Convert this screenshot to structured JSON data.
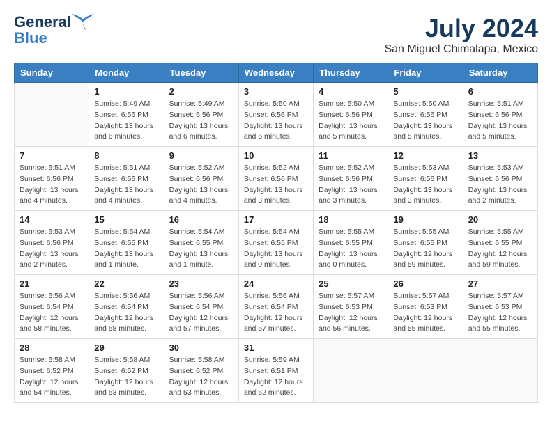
{
  "header": {
    "logo_line1": "General",
    "logo_line2": "Blue",
    "main_title": "July 2024",
    "subtitle": "San Miguel Chimalapa, Mexico"
  },
  "weekdays": [
    "Sunday",
    "Monday",
    "Tuesday",
    "Wednesday",
    "Thursday",
    "Friday",
    "Saturday"
  ],
  "weeks": [
    [
      {
        "day": "",
        "info": ""
      },
      {
        "day": "1",
        "info": "Sunrise: 5:49 AM\nSunset: 6:56 PM\nDaylight: 13 hours\nand 6 minutes."
      },
      {
        "day": "2",
        "info": "Sunrise: 5:49 AM\nSunset: 6:56 PM\nDaylight: 13 hours\nand 6 minutes."
      },
      {
        "day": "3",
        "info": "Sunrise: 5:50 AM\nSunset: 6:56 PM\nDaylight: 13 hours\nand 6 minutes."
      },
      {
        "day": "4",
        "info": "Sunrise: 5:50 AM\nSunset: 6:56 PM\nDaylight: 13 hours\nand 5 minutes."
      },
      {
        "day": "5",
        "info": "Sunrise: 5:50 AM\nSunset: 6:56 PM\nDaylight: 13 hours\nand 5 minutes."
      },
      {
        "day": "6",
        "info": "Sunrise: 5:51 AM\nSunset: 6:56 PM\nDaylight: 13 hours\nand 5 minutes."
      }
    ],
    [
      {
        "day": "7",
        "info": "Sunrise: 5:51 AM\nSunset: 6:56 PM\nDaylight: 13 hours\nand 4 minutes."
      },
      {
        "day": "8",
        "info": "Sunrise: 5:51 AM\nSunset: 6:56 PM\nDaylight: 13 hours\nand 4 minutes."
      },
      {
        "day": "9",
        "info": "Sunrise: 5:52 AM\nSunset: 6:56 PM\nDaylight: 13 hours\nand 4 minutes."
      },
      {
        "day": "10",
        "info": "Sunrise: 5:52 AM\nSunset: 6:56 PM\nDaylight: 13 hours\nand 3 minutes."
      },
      {
        "day": "11",
        "info": "Sunrise: 5:52 AM\nSunset: 6:56 PM\nDaylight: 13 hours\nand 3 minutes."
      },
      {
        "day": "12",
        "info": "Sunrise: 5:53 AM\nSunset: 6:56 PM\nDaylight: 13 hours\nand 3 minutes."
      },
      {
        "day": "13",
        "info": "Sunrise: 5:53 AM\nSunset: 6:56 PM\nDaylight: 13 hours\nand 2 minutes."
      }
    ],
    [
      {
        "day": "14",
        "info": "Sunrise: 5:53 AM\nSunset: 6:56 PM\nDaylight: 13 hours\nand 2 minutes."
      },
      {
        "day": "15",
        "info": "Sunrise: 5:54 AM\nSunset: 6:55 PM\nDaylight: 13 hours\nand 1 minute."
      },
      {
        "day": "16",
        "info": "Sunrise: 5:54 AM\nSunset: 6:55 PM\nDaylight: 13 hours\nand 1 minute."
      },
      {
        "day": "17",
        "info": "Sunrise: 5:54 AM\nSunset: 6:55 PM\nDaylight: 13 hours\nand 0 minutes."
      },
      {
        "day": "18",
        "info": "Sunrise: 5:55 AM\nSunset: 6:55 PM\nDaylight: 13 hours\nand 0 minutes."
      },
      {
        "day": "19",
        "info": "Sunrise: 5:55 AM\nSunset: 6:55 PM\nDaylight: 12 hours\nand 59 minutes."
      },
      {
        "day": "20",
        "info": "Sunrise: 5:55 AM\nSunset: 6:55 PM\nDaylight: 12 hours\nand 59 minutes."
      }
    ],
    [
      {
        "day": "21",
        "info": "Sunrise: 5:56 AM\nSunset: 6:54 PM\nDaylight: 12 hours\nand 58 minutes."
      },
      {
        "day": "22",
        "info": "Sunrise: 5:56 AM\nSunset: 6:54 PM\nDaylight: 12 hours\nand 58 minutes."
      },
      {
        "day": "23",
        "info": "Sunrise: 5:56 AM\nSunset: 6:54 PM\nDaylight: 12 hours\nand 57 minutes."
      },
      {
        "day": "24",
        "info": "Sunrise: 5:56 AM\nSunset: 6:54 PM\nDaylight: 12 hours\nand 57 minutes."
      },
      {
        "day": "25",
        "info": "Sunrise: 5:57 AM\nSunset: 6:53 PM\nDaylight: 12 hours\nand 56 minutes."
      },
      {
        "day": "26",
        "info": "Sunrise: 5:57 AM\nSunset: 6:53 PM\nDaylight: 12 hours\nand 55 minutes."
      },
      {
        "day": "27",
        "info": "Sunrise: 5:57 AM\nSunset: 6:53 PM\nDaylight: 12 hours\nand 55 minutes."
      }
    ],
    [
      {
        "day": "28",
        "info": "Sunrise: 5:58 AM\nSunset: 6:52 PM\nDaylight: 12 hours\nand 54 minutes."
      },
      {
        "day": "29",
        "info": "Sunrise: 5:58 AM\nSunset: 6:52 PM\nDaylight: 12 hours\nand 53 minutes."
      },
      {
        "day": "30",
        "info": "Sunrise: 5:58 AM\nSunset: 6:52 PM\nDaylight: 12 hours\nand 53 minutes."
      },
      {
        "day": "31",
        "info": "Sunrise: 5:59 AM\nSunset: 6:51 PM\nDaylight: 12 hours\nand 52 minutes."
      },
      {
        "day": "",
        "info": ""
      },
      {
        "day": "",
        "info": ""
      },
      {
        "day": "",
        "info": ""
      }
    ]
  ]
}
